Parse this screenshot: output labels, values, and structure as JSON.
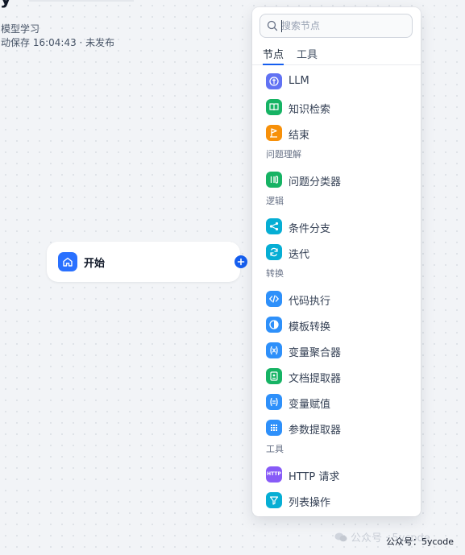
{
  "header": {
    "app_name": "模型学习",
    "save_status": "动保存 16:04:43 · 未发布"
  },
  "canvas": {
    "start_node": {
      "label": "开始",
      "icon": "home-icon"
    },
    "add_node_icon": "plus-icon"
  },
  "node_panel": {
    "search": {
      "placeholder": "搜索节点",
      "value": ""
    },
    "tabs": [
      {
        "label": "节点",
        "active": true
      },
      {
        "label": "工具",
        "active": false
      }
    ],
    "basic_items": [
      {
        "label": "LLM",
        "icon": "llm-icon",
        "color": "#6172f3"
      },
      {
        "label": "知识检索",
        "icon": "book-icon",
        "color": "#16b364"
      },
      {
        "label": "结束",
        "icon": "flag-icon",
        "color": "#f79009"
      }
    ],
    "groups": [
      {
        "label": "问题理解",
        "items": [
          {
            "label": "问题分类器",
            "icon": "classifier-icon",
            "color": "#16b364"
          }
        ]
      },
      {
        "label": "逻辑",
        "items": [
          {
            "label": "条件分支",
            "icon": "branch-icon",
            "color": "#06aed4"
          },
          {
            "label": "迭代",
            "icon": "loop-icon",
            "color": "#06aed4"
          }
        ]
      },
      {
        "label": "转换",
        "items": [
          {
            "label": "代码执行",
            "icon": "code-icon",
            "color": "#2e90fa"
          },
          {
            "label": "模板转换",
            "icon": "template-icon",
            "color": "#2e90fa"
          },
          {
            "label": "变量聚合器",
            "icon": "variable-icon",
            "color": "#2e90fa"
          },
          {
            "label": "文档提取器",
            "icon": "document-icon",
            "color": "#16b364"
          },
          {
            "label": "变量赋值",
            "icon": "assign-icon",
            "color": "#2e90fa"
          },
          {
            "label": "参数提取器",
            "icon": "grid-icon",
            "color": "#2e90fa"
          }
        ]
      },
      {
        "label": "工具",
        "items": [
          {
            "label": "HTTP 请求",
            "icon": "http-icon",
            "color": "#875bf7",
            "badge": "HTTP"
          },
          {
            "label": "列表操作",
            "icon": "filter-icon",
            "color": "#06aed4"
          }
        ]
      }
    ]
  },
  "watermark": {
    "text": "公众号 · 5ycode"
  },
  "footer": {
    "credit": "公众号：5ycode"
  }
}
